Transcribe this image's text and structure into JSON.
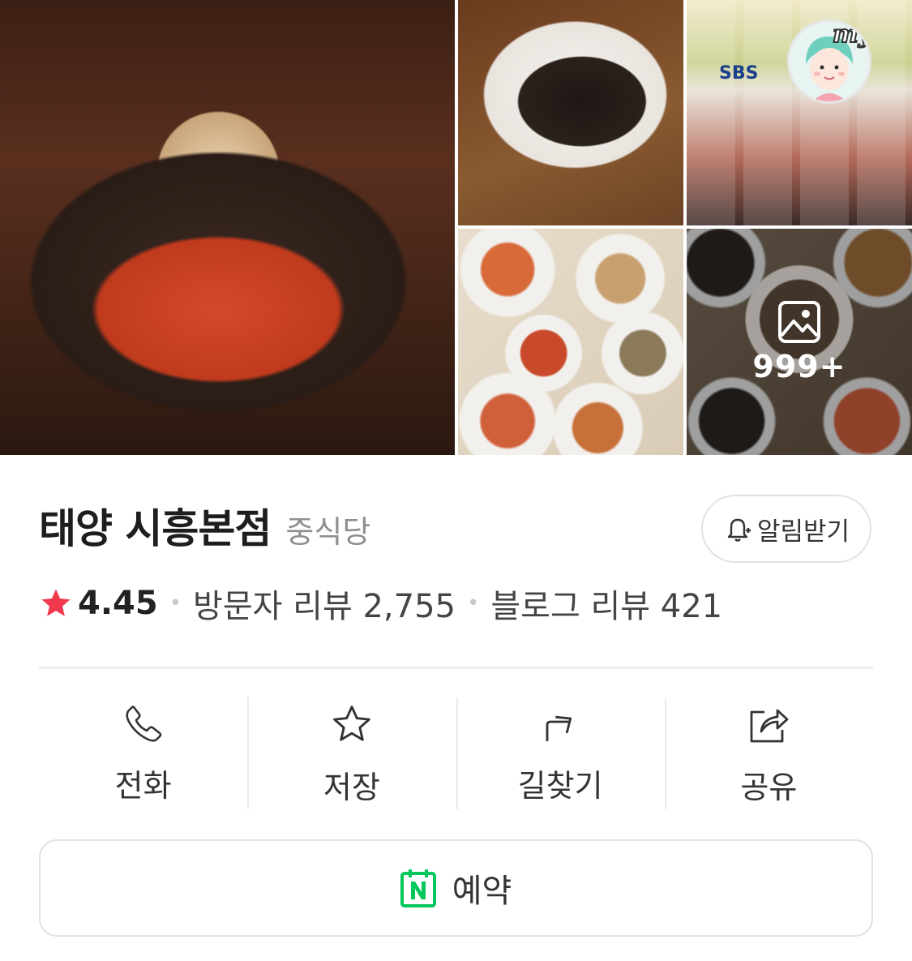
{
  "gallery": {
    "photos": [
      {
        "name": "main-photo-jjamppong"
      },
      {
        "name": "photo-jjajangmyeon"
      },
      {
        "name": "photo-tv-poster"
      },
      {
        "name": "photo-dishes-spread"
      },
      {
        "name": "photo-more"
      }
    ],
    "more_count": "999+",
    "poster_badge_text": "SBS",
    "my_badge_text": "my"
  },
  "place": {
    "name": "태양 시흥본점",
    "category": "중식당",
    "rating": "4.45",
    "visitor_reviews": "방문자 리뷰 2,755",
    "blog_reviews": "블로그 리뷰 421"
  },
  "notify_button": {
    "label": "알림받기",
    "icon": "bell-plus-icon"
  },
  "actions": [
    {
      "label": "전화",
      "icon": "phone-icon"
    },
    {
      "label": "저장",
      "icon": "star-outline-icon"
    },
    {
      "label": "길찾기",
      "icon": "directions-arrow-icon"
    },
    {
      "label": "공유",
      "icon": "share-icon"
    }
  ],
  "reserve_button": {
    "label": "예약",
    "icon": "naver-calendar-icon"
  },
  "colors": {
    "star": "#f0394d",
    "naver_green": "#03c75a",
    "divider": "#eeeeee",
    "muted_text": "#8f8f8f"
  }
}
